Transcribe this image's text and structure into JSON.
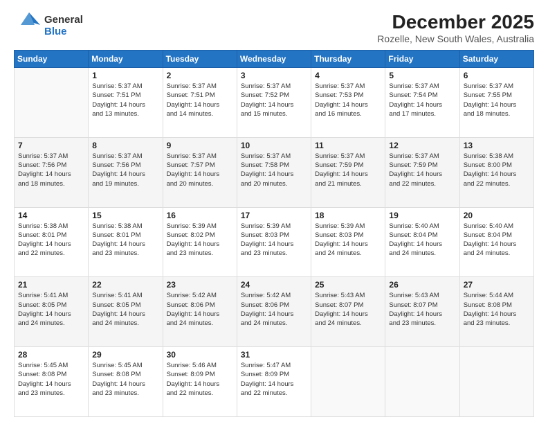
{
  "logo": {
    "line1": "General",
    "line2": "Blue"
  },
  "title": "December 2025",
  "subtitle": "Rozelle, New South Wales, Australia",
  "days_of_week": [
    "Sunday",
    "Monday",
    "Tuesday",
    "Wednesday",
    "Thursday",
    "Friday",
    "Saturday"
  ],
  "weeks": [
    [
      {
        "day": "",
        "info": ""
      },
      {
        "day": "1",
        "info": "Sunrise: 5:37 AM\nSunset: 7:51 PM\nDaylight: 14 hours\nand 13 minutes."
      },
      {
        "day": "2",
        "info": "Sunrise: 5:37 AM\nSunset: 7:51 PM\nDaylight: 14 hours\nand 14 minutes."
      },
      {
        "day": "3",
        "info": "Sunrise: 5:37 AM\nSunset: 7:52 PM\nDaylight: 14 hours\nand 15 minutes."
      },
      {
        "day": "4",
        "info": "Sunrise: 5:37 AM\nSunset: 7:53 PM\nDaylight: 14 hours\nand 16 minutes."
      },
      {
        "day": "5",
        "info": "Sunrise: 5:37 AM\nSunset: 7:54 PM\nDaylight: 14 hours\nand 17 minutes."
      },
      {
        "day": "6",
        "info": "Sunrise: 5:37 AM\nSunset: 7:55 PM\nDaylight: 14 hours\nand 18 minutes."
      }
    ],
    [
      {
        "day": "7",
        "info": "Sunrise: 5:37 AM\nSunset: 7:56 PM\nDaylight: 14 hours\nand 18 minutes."
      },
      {
        "day": "8",
        "info": "Sunrise: 5:37 AM\nSunset: 7:56 PM\nDaylight: 14 hours\nand 19 minutes."
      },
      {
        "day": "9",
        "info": "Sunrise: 5:37 AM\nSunset: 7:57 PM\nDaylight: 14 hours\nand 20 minutes."
      },
      {
        "day": "10",
        "info": "Sunrise: 5:37 AM\nSunset: 7:58 PM\nDaylight: 14 hours\nand 20 minutes."
      },
      {
        "day": "11",
        "info": "Sunrise: 5:37 AM\nSunset: 7:59 PM\nDaylight: 14 hours\nand 21 minutes."
      },
      {
        "day": "12",
        "info": "Sunrise: 5:37 AM\nSunset: 7:59 PM\nDaylight: 14 hours\nand 22 minutes."
      },
      {
        "day": "13",
        "info": "Sunrise: 5:38 AM\nSunset: 8:00 PM\nDaylight: 14 hours\nand 22 minutes."
      }
    ],
    [
      {
        "day": "14",
        "info": "Sunrise: 5:38 AM\nSunset: 8:01 PM\nDaylight: 14 hours\nand 22 minutes."
      },
      {
        "day": "15",
        "info": "Sunrise: 5:38 AM\nSunset: 8:01 PM\nDaylight: 14 hours\nand 23 minutes."
      },
      {
        "day": "16",
        "info": "Sunrise: 5:39 AM\nSunset: 8:02 PM\nDaylight: 14 hours\nand 23 minutes."
      },
      {
        "day": "17",
        "info": "Sunrise: 5:39 AM\nSunset: 8:03 PM\nDaylight: 14 hours\nand 23 minutes."
      },
      {
        "day": "18",
        "info": "Sunrise: 5:39 AM\nSunset: 8:03 PM\nDaylight: 14 hours\nand 24 minutes."
      },
      {
        "day": "19",
        "info": "Sunrise: 5:40 AM\nSunset: 8:04 PM\nDaylight: 14 hours\nand 24 minutes."
      },
      {
        "day": "20",
        "info": "Sunrise: 5:40 AM\nSunset: 8:04 PM\nDaylight: 14 hours\nand 24 minutes."
      }
    ],
    [
      {
        "day": "21",
        "info": "Sunrise: 5:41 AM\nSunset: 8:05 PM\nDaylight: 14 hours\nand 24 minutes."
      },
      {
        "day": "22",
        "info": "Sunrise: 5:41 AM\nSunset: 8:05 PM\nDaylight: 14 hours\nand 24 minutes."
      },
      {
        "day": "23",
        "info": "Sunrise: 5:42 AM\nSunset: 8:06 PM\nDaylight: 14 hours\nand 24 minutes."
      },
      {
        "day": "24",
        "info": "Sunrise: 5:42 AM\nSunset: 8:06 PM\nDaylight: 14 hours\nand 24 minutes."
      },
      {
        "day": "25",
        "info": "Sunrise: 5:43 AM\nSunset: 8:07 PM\nDaylight: 14 hours\nand 24 minutes."
      },
      {
        "day": "26",
        "info": "Sunrise: 5:43 AM\nSunset: 8:07 PM\nDaylight: 14 hours\nand 23 minutes."
      },
      {
        "day": "27",
        "info": "Sunrise: 5:44 AM\nSunset: 8:08 PM\nDaylight: 14 hours\nand 23 minutes."
      }
    ],
    [
      {
        "day": "28",
        "info": "Sunrise: 5:45 AM\nSunset: 8:08 PM\nDaylight: 14 hours\nand 23 minutes."
      },
      {
        "day": "29",
        "info": "Sunrise: 5:45 AM\nSunset: 8:08 PM\nDaylight: 14 hours\nand 23 minutes."
      },
      {
        "day": "30",
        "info": "Sunrise: 5:46 AM\nSunset: 8:09 PM\nDaylight: 14 hours\nand 22 minutes."
      },
      {
        "day": "31",
        "info": "Sunrise: 5:47 AM\nSunset: 8:09 PM\nDaylight: 14 hours\nand 22 minutes."
      },
      {
        "day": "",
        "info": ""
      },
      {
        "day": "",
        "info": ""
      },
      {
        "day": "",
        "info": ""
      }
    ]
  ]
}
